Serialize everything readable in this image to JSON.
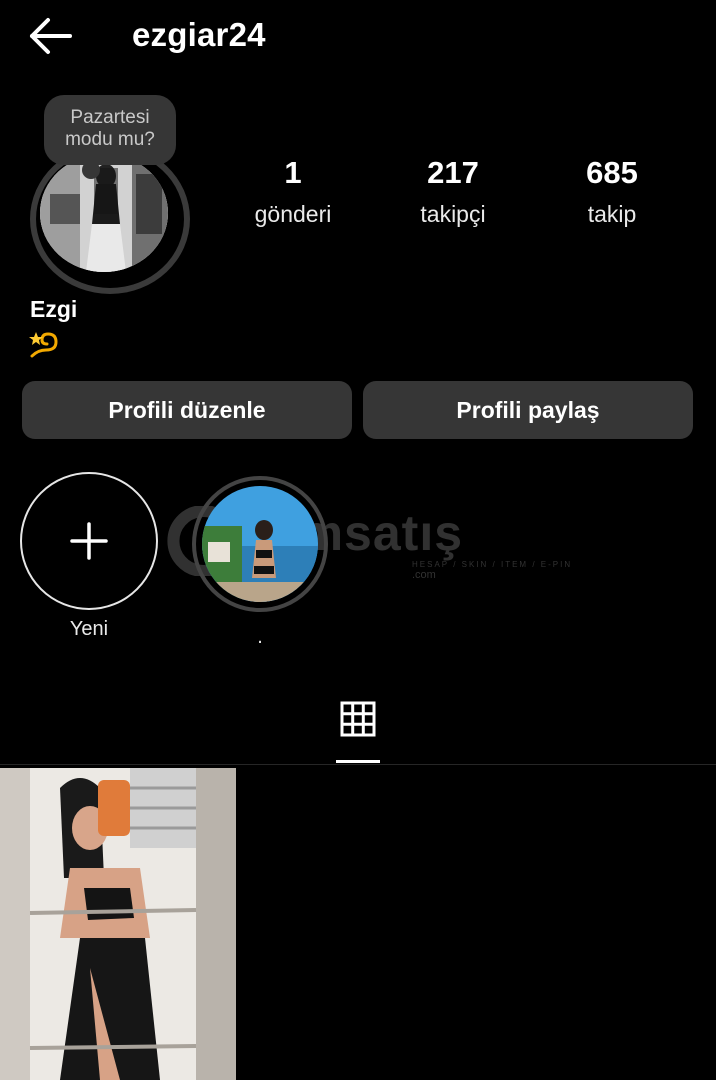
{
  "header": {
    "username": "ezgiar24"
  },
  "note": {
    "line1": "Pazartesi",
    "line2": "modu mu?"
  },
  "stats": [
    {
      "value": "1",
      "label": "gönderi"
    },
    {
      "value": "217",
      "label": "takipçi"
    },
    {
      "value": "685",
      "label": "takip"
    }
  ],
  "profile": {
    "display_name": "Ezgi",
    "bio_icon": "dizzy-emoji"
  },
  "buttons": {
    "edit": "Profili düzenle",
    "share": "Profili paylaş"
  },
  "highlights": [
    {
      "label": "Yeni",
      "icon": "plus-icon"
    },
    {
      "label": "."
    }
  ],
  "watermark": {
    "text": "ilemsatış",
    "sub": "HESAP / SKIN / ITEM / E-PIN",
    "suffix": ".com"
  },
  "tabs": [
    {
      "icon": "grid-icon",
      "active": true
    }
  ],
  "posts_count_shown": 1
}
